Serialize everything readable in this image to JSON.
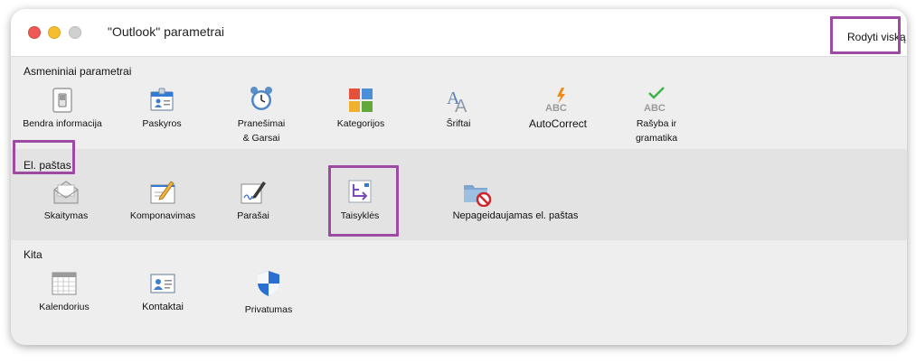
{
  "window": {
    "title": "\"Outlook\" parametrai",
    "show_all": "Rodyti viską",
    "highlight_color": "#9c4aa2"
  },
  "sections": {
    "personal": {
      "title": "Asmeniniai parametrai",
      "items": [
        {
          "label": "Bendra informacija",
          "icon": "light-switch-icon"
        },
        {
          "label": "Paskyros",
          "icon": "accounts-card-icon"
        },
        {
          "label": "Pranešimai\n& Garsai",
          "icon": "alarm-clock-icon"
        },
        {
          "label": "Kategorijos",
          "icon": "categories-squares-icon"
        },
        {
          "label": "Šriftai",
          "icon": "fonts-icon"
        },
        {
          "label": "AutoCorrect",
          "icon": "autocorrect-icon"
        },
        {
          "label": "Rašyba ir\ngramatika",
          "icon": "spelling-check-icon"
        }
      ]
    },
    "mail": {
      "title": "El. paštas",
      "items": [
        {
          "label": "Skaitymas",
          "icon": "envelope-icon"
        },
        {
          "label": "Komponavimas",
          "icon": "compose-icon"
        },
        {
          "label": "Parašai",
          "icon": "signature-icon"
        },
        {
          "label": "Taisyklės",
          "icon": "rules-icon"
        },
        {
          "label": "Nepageidaujamas el. paštas",
          "icon": "junk-folder-icon"
        }
      ]
    },
    "other": {
      "title": "Kita",
      "items": [
        {
          "label": "Kalendorius",
          "icon": "calendar-icon"
        },
        {
          "label": "Kontaktai",
          "icon": "contacts-card-icon"
        },
        {
          "label": "Privatumas",
          "icon": "privacy-shield-icon"
        }
      ]
    }
  }
}
